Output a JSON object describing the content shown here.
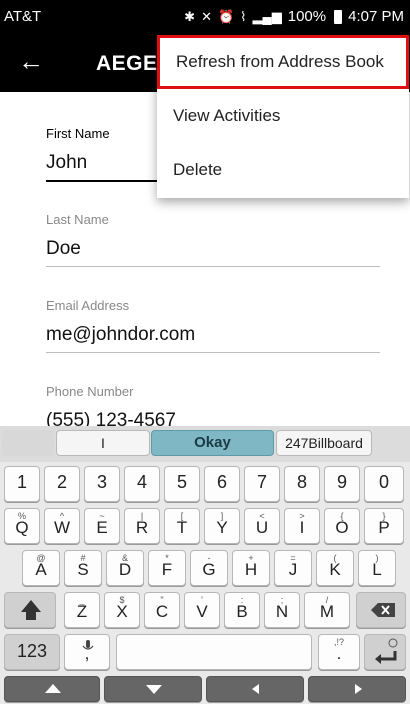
{
  "status_bar": {
    "carrier": "AT&T",
    "battery": "100%",
    "time": "4:07 PM",
    "icons": [
      "bluetooth-icon",
      "mute-icon",
      "alarm-icon",
      "wifi-icon",
      "signal-icon",
      "battery-icon"
    ]
  },
  "app_bar": {
    "title": "AEGE/",
    "back_icon": "arrow-left-icon"
  },
  "form": {
    "first_name": {
      "label": "First Name",
      "value": "John"
    },
    "last_name": {
      "label": "Last Name",
      "value": "Doe"
    },
    "email": {
      "label": "Email Address",
      "value": "me@johndor.com"
    },
    "phone": {
      "label": "Phone Number",
      "value": "(555) 123-4567"
    }
  },
  "menu": {
    "items": [
      {
        "label": "Refresh from Address Book",
        "highlighted": true
      },
      {
        "label": "View Activities",
        "highlighted": false
      },
      {
        "label": "Delete",
        "highlighted": false
      }
    ],
    "highlight_color": "#e01010"
  },
  "keyboard": {
    "suggestions": [
      "I",
      "Okay",
      "247Billboard"
    ],
    "number_row": [
      "1",
      "2",
      "3",
      "4",
      "5",
      "6",
      "7",
      "8",
      "9",
      "0"
    ],
    "row1": [
      {
        "main": "Q",
        "sub": "%"
      },
      {
        "main": "W",
        "sub": "^"
      },
      {
        "main": "E",
        "sub": "~"
      },
      {
        "main": "R",
        "sub": "|"
      },
      {
        "main": "T",
        "sub": "["
      },
      {
        "main": "Y",
        "sub": "]"
      },
      {
        "main": "U",
        "sub": "<"
      },
      {
        "main": "I",
        "sub": ">"
      },
      {
        "main": "O",
        "sub": "{"
      },
      {
        "main": "P",
        "sub": "}"
      }
    ],
    "row2": [
      {
        "main": "A",
        "sub": "@"
      },
      {
        "main": "S",
        "sub": "#"
      },
      {
        "main": "D",
        "sub": "&"
      },
      {
        "main": "F",
        "sub": "*"
      },
      {
        "main": "G",
        "sub": "-"
      },
      {
        "main": "H",
        "sub": "+"
      },
      {
        "main": "J",
        "sub": "="
      },
      {
        "main": "K",
        "sub": "("
      },
      {
        "main": "L",
        "sub": ")"
      }
    ],
    "row3": [
      {
        "main": "Z",
        "sub": "_"
      },
      {
        "main": "X",
        "sub": "$"
      },
      {
        "main": "C",
        "sub": "\""
      },
      {
        "main": "V",
        "sub": "'"
      },
      {
        "main": "B",
        "sub": ":"
      },
      {
        "main": "N",
        "sub": ";"
      },
      {
        "main": "M",
        "sub": "/"
      }
    ],
    "bottom": {
      "mode": "123",
      "comma": ",",
      "period": ".",
      "period_sub": ",!?"
    },
    "accent_color": "#7fb7c4"
  }
}
